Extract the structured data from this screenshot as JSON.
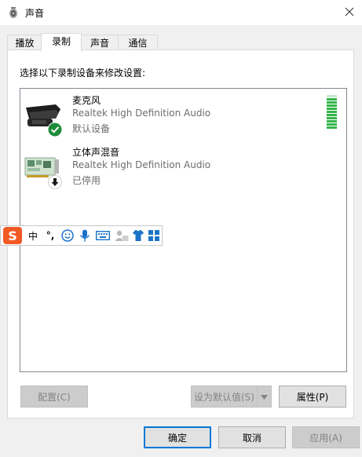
{
  "window": {
    "title": "声音",
    "title_icon": "speaker-icon",
    "close_icon": "close-icon"
  },
  "tabs": [
    {
      "label": "播放",
      "active": false
    },
    {
      "label": "录制",
      "active": true
    },
    {
      "label": "声音",
      "active": false
    },
    {
      "label": "通信",
      "active": false
    }
  ],
  "panel": {
    "instruction": "选择以下录制设备来修改设置:"
  },
  "devices": [
    {
      "name": "麦克风",
      "driver": "Realtek High Definition Audio",
      "status": "默认设备",
      "icon": "microphone-icon",
      "badge": "default-check-icon",
      "meter_level": 1.0
    },
    {
      "name": "立体声混音",
      "driver": "Realtek High Definition Audio",
      "status": "已停用",
      "icon": "sound-card-icon",
      "badge": "disabled-arrow-icon"
    }
  ],
  "ime_toolbar": {
    "items": [
      "sogou-logo-icon",
      "中",
      "°,",
      "emoji-icon",
      "voice-icon",
      "keyboard-icon",
      "user-card-icon",
      "skin-icon",
      "toolbox-icon"
    ]
  },
  "panel_buttons": {
    "configure": "配置(C)",
    "set_default": "设为默认值(S)",
    "properties": "属性(P)"
  },
  "dialog_buttons": {
    "ok": "确定",
    "cancel": "取消",
    "apply": "应用(A)"
  },
  "colors": {
    "meter_green": "#34b54a",
    "meter_inactive": "#c6e9cc",
    "check_green": "#1e8c3a",
    "accent": "#0078d7"
  }
}
